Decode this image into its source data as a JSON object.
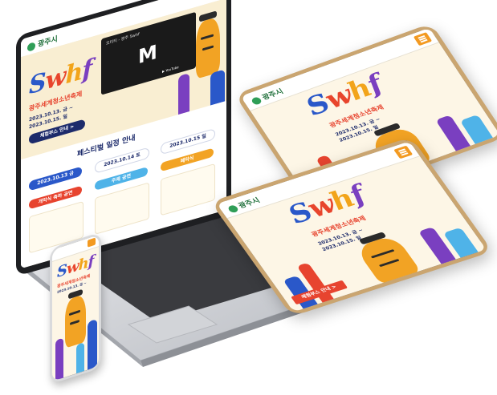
{
  "brand": {
    "logo_text": "광주시",
    "accent": "#f39a21",
    "green": "#2f9e57"
  },
  "hero": {
    "logo": {
      "s": "S",
      "w": "w",
      "h": "h",
      "f": "f"
    },
    "title_kr": "광주세계청소년축제",
    "date_line1": "2023.10.13. 금 ~",
    "date_line2": "2023.10.15. 일",
    "cta": "체험부스 안내 >"
  },
  "video": {
    "label": "오티티 - 광주 Swhf",
    "watch_label": "▶ YouTube"
  },
  "schedule": {
    "heading": "페스티벌 일정 안내",
    "days": [
      "2023.10.13 금",
      "2023.10.14 토",
      "2023.10.15 일"
    ],
    "tags": [
      "개막식 축하 공연",
      "주제 공연",
      "폐막식"
    ]
  },
  "tablet_bottom_strip": "체험부스 안내 >",
  "colors": {
    "cream": "#fdf6e6",
    "red": "#e7442f",
    "navy": "#1d2b6b",
    "blue": "#2a58c9",
    "purple": "#7a3fc0",
    "orange": "#f2a324"
  }
}
